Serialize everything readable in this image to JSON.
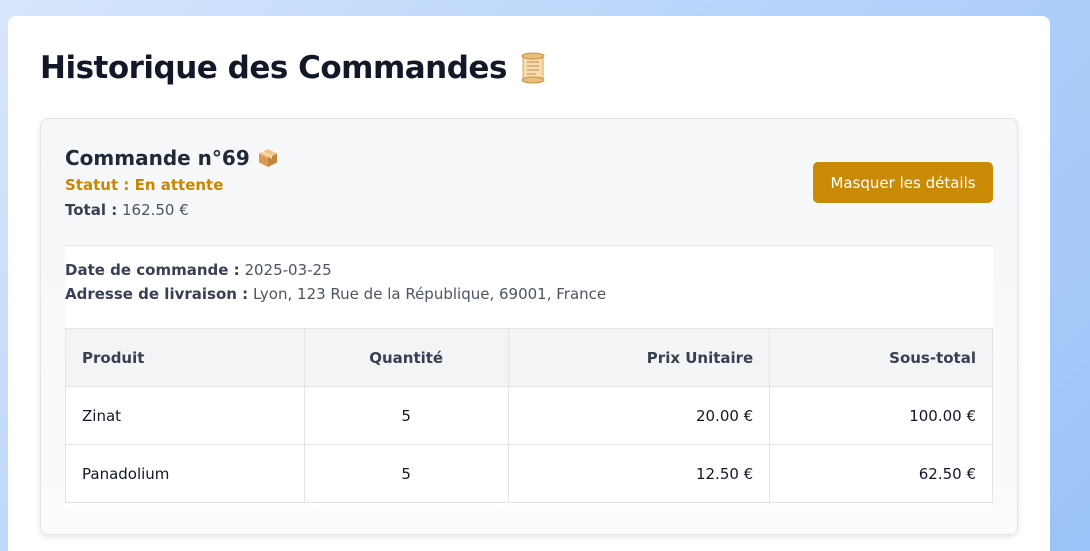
{
  "page": {
    "title": "Historique des Commandes",
    "title_icon": "scroll-icon"
  },
  "order": {
    "title": "Commande n°69",
    "title_icon": "package-icon",
    "status_label": "Statut :",
    "status_value": "En attente",
    "status_color": "#c98600",
    "total_label": "Total :",
    "total_value": "162.50 €",
    "toggle_label": "Masquer les détails",
    "button_color": "#c98a05",
    "date_label": "Date de commande :",
    "date_value": "2025-03-25",
    "address_label": "Adresse de livraison :",
    "address_value": "Lyon, 123 Rue de la République, 69001, France",
    "table": {
      "headers": {
        "product": "Produit",
        "quantity": "Quantité",
        "unit_price": "Prix Unitaire",
        "subtotal": "Sous-total"
      },
      "rows": [
        {
          "product": "Zinat",
          "quantity": "5",
          "unit_price": "20.00 €",
          "subtotal": "100.00 €"
        },
        {
          "product": "Panadolium",
          "quantity": "5",
          "unit_price": "12.50 €",
          "subtotal": "62.50 €"
        }
      ]
    }
  }
}
